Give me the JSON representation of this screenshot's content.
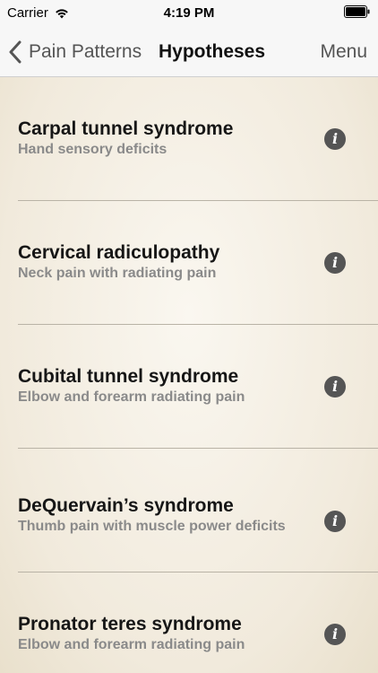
{
  "status_bar": {
    "carrier": "Carrier",
    "time": "4:19 PM"
  },
  "nav": {
    "back_label": "Pain Patterns",
    "title": "Hypotheses",
    "menu_label": "Menu"
  },
  "list": {
    "info_glyph": "i",
    "items": [
      {
        "title": "Carpal tunnel syndrome",
        "subtitle": "Hand sensory deficits"
      },
      {
        "title": "Cervical radiculopathy",
        "subtitle": "Neck pain with radiating pain"
      },
      {
        "title": "Cubital tunnel syndrome",
        "subtitle": "Elbow and forearm radiating pain"
      },
      {
        "title": "DeQuervain’s syndrome",
        "subtitle": "Thumb pain with muscle power deficits"
      },
      {
        "title": "Pronator teres syndrome",
        "subtitle": "Elbow and forearm radiating pain"
      }
    ]
  },
  "colors": {
    "background": "#f4efe4",
    "title_text": "#161616",
    "subtitle_text": "#8a8a8a",
    "info_icon": "#555555",
    "separator": "#b9b3a6"
  }
}
